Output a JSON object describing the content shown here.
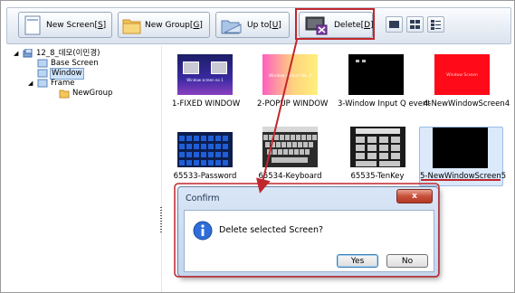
{
  "toolbar": {
    "buttons": [
      {
        "label": "New Screen",
        "accel": "S"
      },
      {
        "label": "New Group",
        "accel": "G"
      },
      {
        "label": "Up to",
        "accel": "U"
      },
      {
        "label": "Delete",
        "accel": "D"
      }
    ],
    "view_modes": [
      "large-icons",
      "small-icons",
      "details"
    ]
  },
  "tree": {
    "root": "12_8_데모(이민경)",
    "items": [
      "Base Screen",
      "Window",
      "Frame",
      "NewGroup"
    ],
    "selected": "Window"
  },
  "thumbnails": [
    {
      "caption": "1-FIXED WINDOW",
      "preview_text": "Window screen no 1"
    },
    {
      "caption": "2-POPUP WINDOW",
      "preview_text": "Window screen No. 2"
    },
    {
      "caption": "3-Window Input Q event",
      "preview_text": ""
    },
    {
      "caption": "4-NewWindowScreen4",
      "preview_text": "Window Screen"
    },
    {
      "caption": "65533-Password",
      "preview_text": ""
    },
    {
      "caption": "65534-Keyboard",
      "preview_text": ""
    },
    {
      "caption": "65535-TenKey",
      "preview_text": ""
    },
    {
      "caption": "5-NewWindowScreen5",
      "preview_text": ""
    }
  ],
  "dialog": {
    "title": "Confirm",
    "close_label": "x",
    "message": "Delete selected Screen?",
    "yes_label": "Yes",
    "no_label": "No"
  },
  "colors": {
    "highlight": "#c0272d",
    "selection": "#dbe9fb"
  }
}
